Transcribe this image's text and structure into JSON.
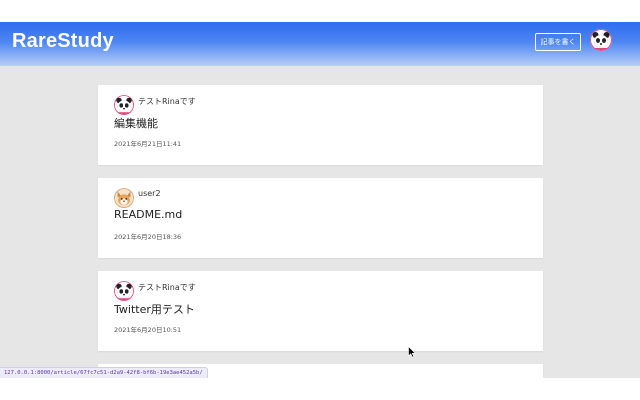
{
  "header": {
    "logo": "RareStudy",
    "write_button": "記事を書く",
    "avatar_icon": "panda-avatar-icon"
  },
  "articles": [
    {
      "author": "テストRinaです",
      "title": "編集機能",
      "date": "2021年6月21日11:41",
      "avatar_icon": "panda-avatar-icon"
    },
    {
      "author": "user2",
      "title": "README.md",
      "date": "2021年6月20日18:36",
      "avatar_icon": "fox-avatar-icon"
    },
    {
      "author": "テストRinaです",
      "title": "Twitter用テスト",
      "date": "2021年6月20日10:51",
      "avatar_icon": "panda-avatar-icon"
    }
  ],
  "status_url": "127.0.0.1:8000/article/67fc7c51-d2a9-42f8-bf6b-19e3ae452a5b/",
  "colors": {
    "header_gradient_top": "#2f6bf0",
    "header_gradient_bottom": "#b7cff8",
    "page_background": "#e6e6e6",
    "card_background": "#ffffff",
    "panda_accent": "#e0457b"
  }
}
